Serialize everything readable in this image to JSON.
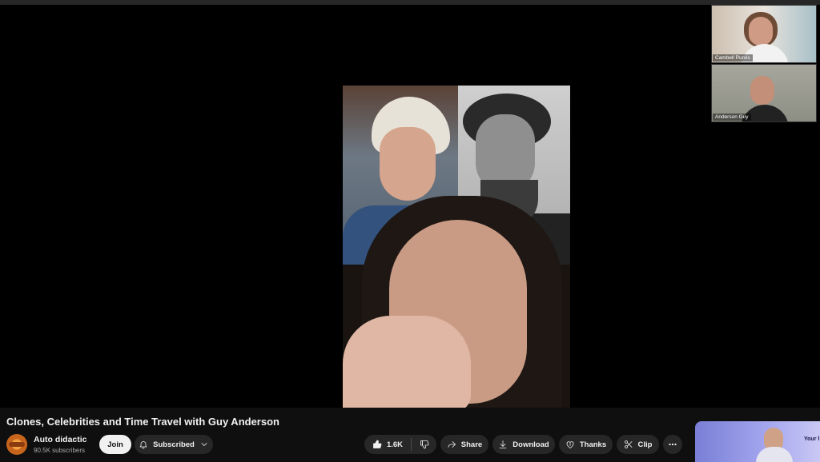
{
  "video": {
    "title": "Clones, Celebrities and Time Travel with Guy Anderson"
  },
  "participants": [
    {
      "name": "Cambell Purvis"
    },
    {
      "name": "Anderson Guy"
    }
  ],
  "channel": {
    "name": "Auto didactic",
    "subscribers": "90.5K subscribers"
  },
  "actions": {
    "join": "Join",
    "subscribed": "Subscribed",
    "likes": "1.6K",
    "share": "Share",
    "download": "Download",
    "thanks": "Thanks",
    "clip": "Clip"
  },
  "ad": {
    "text": "Your l"
  },
  "icons": {
    "subscribed": "bell-icon",
    "subscribed_menu": "chevron-down-icon",
    "like": "thumbs-up-icon",
    "dislike": "thumbs-down-icon",
    "share": "share-arrow-icon",
    "download": "download-icon",
    "thanks": "heart-dollar-icon",
    "clip": "scissors-icon",
    "more": "more-horizontal-icon"
  }
}
